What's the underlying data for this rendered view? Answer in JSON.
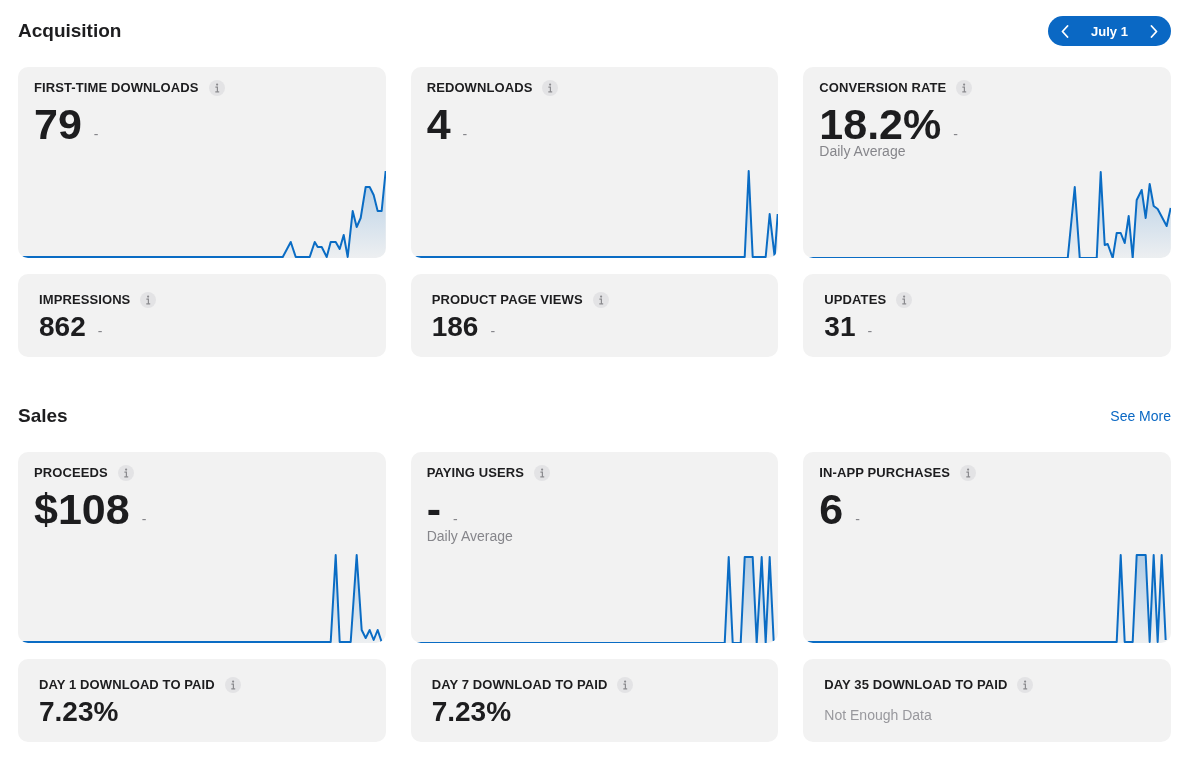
{
  "sections": [
    {
      "title": "Acquisition",
      "date_nav": {
        "label": "July 1"
      },
      "cards": [
        {
          "kind": "chart",
          "label": "FIRST-TIME DOWNLOADS",
          "value": "79",
          "change": "-"
        },
        {
          "kind": "chart",
          "label": "REDOWNLOADS",
          "value": "4",
          "change": "-"
        },
        {
          "kind": "chart",
          "label": "CONVERSION RATE",
          "value": "18.2%",
          "change": "-",
          "subtitle": "Daily Average"
        },
        {
          "kind": "stat",
          "label": "IMPRESSIONS",
          "value": "862",
          "change": "-"
        },
        {
          "kind": "stat",
          "label": "PRODUCT PAGE VIEWS",
          "value": "186",
          "change": "-"
        },
        {
          "kind": "stat",
          "label": "UPDATES",
          "value": "31",
          "change": "-"
        }
      ]
    },
    {
      "title": "Sales",
      "link": "See More",
      "cards": [
        {
          "kind": "chart",
          "label": "PROCEEDS",
          "value": "$108",
          "change": "-"
        },
        {
          "kind": "chart",
          "label": "PAYING USERS",
          "value": "-",
          "change": "-",
          "subtitle": "Daily Average"
        },
        {
          "kind": "chart",
          "label": "IN-APP PURCHASES",
          "value": "6",
          "change": "-"
        },
        {
          "kind": "stat",
          "label": "DAY 1 DOWNLOAD TO PAID",
          "value": "7.23%"
        },
        {
          "kind": "stat",
          "label": "DAY 7 DOWNLOAD TO PAID",
          "value": "7.23%"
        },
        {
          "kind": "stat",
          "label": "DAY 35 DOWNLOAD TO PAID",
          "note": "Not Enough Data"
        }
      ]
    }
  ]
}
